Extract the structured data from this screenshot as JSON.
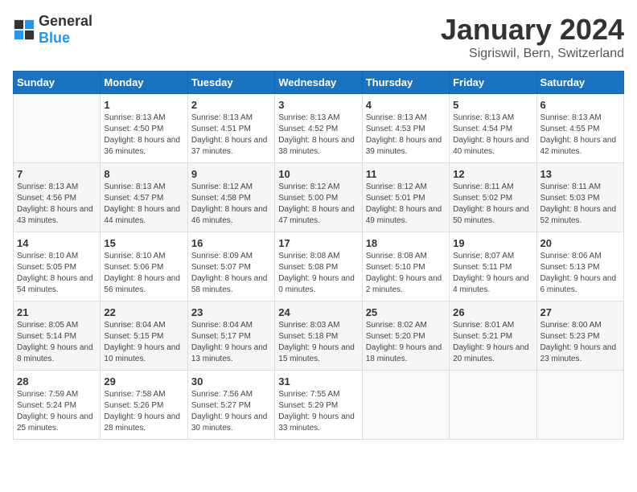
{
  "header": {
    "logo_general": "General",
    "logo_blue": "Blue",
    "month_title": "January 2024",
    "location": "Sigriswil, Bern, Switzerland"
  },
  "days_of_week": [
    "Sunday",
    "Monday",
    "Tuesday",
    "Wednesday",
    "Thursday",
    "Friday",
    "Saturday"
  ],
  "weeks": [
    [
      {
        "day": "",
        "sunrise": "",
        "sunset": "",
        "daylight": ""
      },
      {
        "day": "1",
        "sunrise": "Sunrise: 8:13 AM",
        "sunset": "Sunset: 4:50 PM",
        "daylight": "Daylight: 8 hours and 36 minutes."
      },
      {
        "day": "2",
        "sunrise": "Sunrise: 8:13 AM",
        "sunset": "Sunset: 4:51 PM",
        "daylight": "Daylight: 8 hours and 37 minutes."
      },
      {
        "day": "3",
        "sunrise": "Sunrise: 8:13 AM",
        "sunset": "Sunset: 4:52 PM",
        "daylight": "Daylight: 8 hours and 38 minutes."
      },
      {
        "day": "4",
        "sunrise": "Sunrise: 8:13 AM",
        "sunset": "Sunset: 4:53 PM",
        "daylight": "Daylight: 8 hours and 39 minutes."
      },
      {
        "day": "5",
        "sunrise": "Sunrise: 8:13 AM",
        "sunset": "Sunset: 4:54 PM",
        "daylight": "Daylight: 8 hours and 40 minutes."
      },
      {
        "day": "6",
        "sunrise": "Sunrise: 8:13 AM",
        "sunset": "Sunset: 4:55 PM",
        "daylight": "Daylight: 8 hours and 42 minutes."
      }
    ],
    [
      {
        "day": "7",
        "sunrise": "Sunrise: 8:13 AM",
        "sunset": "Sunset: 4:56 PM",
        "daylight": "Daylight: 8 hours and 43 minutes."
      },
      {
        "day": "8",
        "sunrise": "Sunrise: 8:13 AM",
        "sunset": "Sunset: 4:57 PM",
        "daylight": "Daylight: 8 hours and 44 minutes."
      },
      {
        "day": "9",
        "sunrise": "Sunrise: 8:12 AM",
        "sunset": "Sunset: 4:58 PM",
        "daylight": "Daylight: 8 hours and 46 minutes."
      },
      {
        "day": "10",
        "sunrise": "Sunrise: 8:12 AM",
        "sunset": "Sunset: 5:00 PM",
        "daylight": "Daylight: 8 hours and 47 minutes."
      },
      {
        "day": "11",
        "sunrise": "Sunrise: 8:12 AM",
        "sunset": "Sunset: 5:01 PM",
        "daylight": "Daylight: 8 hours and 49 minutes."
      },
      {
        "day": "12",
        "sunrise": "Sunrise: 8:11 AM",
        "sunset": "Sunset: 5:02 PM",
        "daylight": "Daylight: 8 hours and 50 minutes."
      },
      {
        "day": "13",
        "sunrise": "Sunrise: 8:11 AM",
        "sunset": "Sunset: 5:03 PM",
        "daylight": "Daylight: 8 hours and 52 minutes."
      }
    ],
    [
      {
        "day": "14",
        "sunrise": "Sunrise: 8:10 AM",
        "sunset": "Sunset: 5:05 PM",
        "daylight": "Daylight: 8 hours and 54 minutes."
      },
      {
        "day": "15",
        "sunrise": "Sunrise: 8:10 AM",
        "sunset": "Sunset: 5:06 PM",
        "daylight": "Daylight: 8 hours and 56 minutes."
      },
      {
        "day": "16",
        "sunrise": "Sunrise: 8:09 AM",
        "sunset": "Sunset: 5:07 PM",
        "daylight": "Daylight: 8 hours and 58 minutes."
      },
      {
        "day": "17",
        "sunrise": "Sunrise: 8:08 AM",
        "sunset": "Sunset: 5:08 PM",
        "daylight": "Daylight: 9 hours and 0 minutes."
      },
      {
        "day": "18",
        "sunrise": "Sunrise: 8:08 AM",
        "sunset": "Sunset: 5:10 PM",
        "daylight": "Daylight: 9 hours and 2 minutes."
      },
      {
        "day": "19",
        "sunrise": "Sunrise: 8:07 AM",
        "sunset": "Sunset: 5:11 PM",
        "daylight": "Daylight: 9 hours and 4 minutes."
      },
      {
        "day": "20",
        "sunrise": "Sunrise: 8:06 AM",
        "sunset": "Sunset: 5:13 PM",
        "daylight": "Daylight: 9 hours and 6 minutes."
      }
    ],
    [
      {
        "day": "21",
        "sunrise": "Sunrise: 8:05 AM",
        "sunset": "Sunset: 5:14 PM",
        "daylight": "Daylight: 9 hours and 8 minutes."
      },
      {
        "day": "22",
        "sunrise": "Sunrise: 8:04 AM",
        "sunset": "Sunset: 5:15 PM",
        "daylight": "Daylight: 9 hours and 10 minutes."
      },
      {
        "day": "23",
        "sunrise": "Sunrise: 8:04 AM",
        "sunset": "Sunset: 5:17 PM",
        "daylight": "Daylight: 9 hours and 13 minutes."
      },
      {
        "day": "24",
        "sunrise": "Sunrise: 8:03 AM",
        "sunset": "Sunset: 5:18 PM",
        "daylight": "Daylight: 9 hours and 15 minutes."
      },
      {
        "day": "25",
        "sunrise": "Sunrise: 8:02 AM",
        "sunset": "Sunset: 5:20 PM",
        "daylight": "Daylight: 9 hours and 18 minutes."
      },
      {
        "day": "26",
        "sunrise": "Sunrise: 8:01 AM",
        "sunset": "Sunset: 5:21 PM",
        "daylight": "Daylight: 9 hours and 20 minutes."
      },
      {
        "day": "27",
        "sunrise": "Sunrise: 8:00 AM",
        "sunset": "Sunset: 5:23 PM",
        "daylight": "Daylight: 9 hours and 23 minutes."
      }
    ],
    [
      {
        "day": "28",
        "sunrise": "Sunrise: 7:59 AM",
        "sunset": "Sunset: 5:24 PM",
        "daylight": "Daylight: 9 hours and 25 minutes."
      },
      {
        "day": "29",
        "sunrise": "Sunrise: 7:58 AM",
        "sunset": "Sunset: 5:26 PM",
        "daylight": "Daylight: 9 hours and 28 minutes."
      },
      {
        "day": "30",
        "sunrise": "Sunrise: 7:56 AM",
        "sunset": "Sunset: 5:27 PM",
        "daylight": "Daylight: 9 hours and 30 minutes."
      },
      {
        "day": "31",
        "sunrise": "Sunrise: 7:55 AM",
        "sunset": "Sunset: 5:29 PM",
        "daylight": "Daylight: 9 hours and 33 minutes."
      },
      {
        "day": "",
        "sunrise": "",
        "sunset": "",
        "daylight": ""
      },
      {
        "day": "",
        "sunrise": "",
        "sunset": "",
        "daylight": ""
      },
      {
        "day": "",
        "sunrise": "",
        "sunset": "",
        "daylight": ""
      }
    ]
  ]
}
